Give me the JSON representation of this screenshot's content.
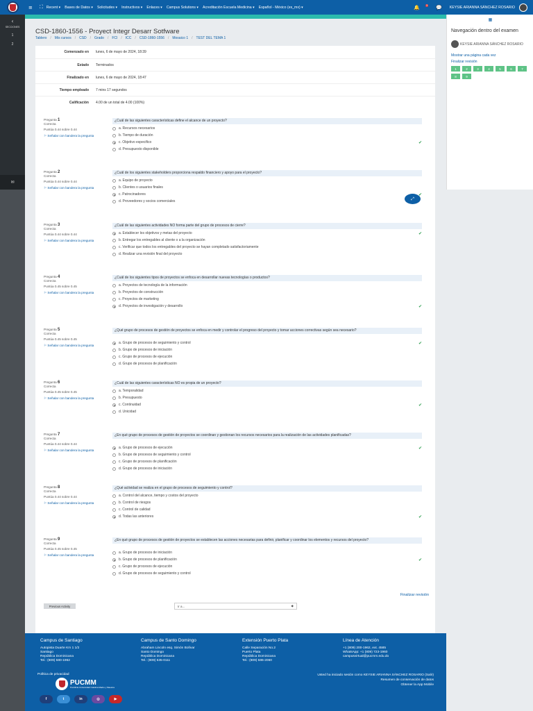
{
  "topbar": {
    "menu": [
      "Recent ▾",
      "Bases de Datos ▾",
      "Solicitudes ▾",
      "Instructivos ▾",
      "Enlaces ▾",
      "Campus Solutions ▾",
      "Acreditación Escuela Medicina ▾",
      "Español - México (es_mx) ▾"
    ],
    "notif_count": "3",
    "user_name": "KEYSIE ARIANNA SÁNCHEZ ROSARIO"
  },
  "leftrail": {
    "label": "SECCIONES",
    "items": [
      "1",
      "2"
    ]
  },
  "page": {
    "title": "CSD-1860-1556 - Proyect Integr Desarr Sotfware",
    "breadcrumb": [
      "Tablero",
      "Mis cursos",
      "CSD",
      "Grado",
      "FCI",
      "ICC",
      "CSD-1860-1556",
      "Mosaico 1",
      "TEST DEL TEMA 1"
    ]
  },
  "summary": [
    {
      "label": "Comenzado en",
      "value": "lunes, 6 de mayo de 2024, 18:39"
    },
    {
      "label": "Estado",
      "value": "Terminados"
    },
    {
      "label": "Finalizado en",
      "value": "lunes, 6 de mayo de 2024, 18:47"
    },
    {
      "label": "Tiempo empleado",
      "value": "7 mins 17 segundos"
    },
    {
      "label": "Calificación",
      "value": "4.00 de un total de 4.00 (100%)"
    }
  ],
  "question_labels": {
    "prefix": "Pregunta",
    "flag": "Señalar con bandera la pregunta"
  },
  "questions": [
    {
      "num": "1",
      "status": "Correcta",
      "grade": "Puntúa 0.44 sobre 0.44",
      "text": "¿Cuál de las siguientes características define el alcance de un proyecto?",
      "options": [
        "a. Recursos necesarios",
        "b. Tiempo de duración",
        "c. Objetivo especifico",
        "d. Presupuesto disponible"
      ],
      "selected": 2
    },
    {
      "num": "2",
      "status": "Correcta",
      "grade": "Puntúa 0.44 sobre 0.44",
      "text": "¿Cuál de los siguientes stakeholders proporciona respaldo financiero y apoyo para el proyecto?",
      "options": [
        "a. Equipo de proyecto",
        "b. Clientes o usuarios finales",
        "c. Patrocinadores",
        "d. Proveedores y socios comerciales"
      ],
      "selected": 2
    },
    {
      "num": "3",
      "status": "Correcta",
      "grade": "Puntúa 0.44 sobre 0.44",
      "text": "¿Cuál de las siguientes actividades NO forma parte del grupo de procesos de cierre?",
      "options": [
        "a. Establecer los objetivos y metas del proyecto",
        "b. Entregar los entregables al cliente o a la organización",
        "c. Verificar que todos los entregables del proyecto se hayan completado satisfactoriamente",
        "d. Realizar una revisión final del proyecto"
      ],
      "selected": 0
    },
    {
      "num": "4",
      "status": "Correcta",
      "grade": "Puntúa 0.45 sobre 0.45",
      "text": "¿Cuál de los siguientes tipos de proyectos se enfoca en desarrollar nuevas tecnologías o productos?",
      "options": [
        "a. Proyectos de tecnología de la información",
        "b. Proyectos de construcción",
        "c. Proyectos de marketing",
        "d. Proyectos de investigación y desarrollo"
      ],
      "selected": 3
    },
    {
      "num": "5",
      "status": "Correcta",
      "grade": "Puntúa 0.45 sobre 0.45",
      "text": "¿Qué grupo de procesos de gestión de proyectos se enfoca en medir y controlar el progreso del proyecto y tomar acciones correctivas según sea necesario?",
      "options": [
        "a. Grupo de procesos de seguimiento y control",
        "b. Grupo de procesos de iniciación",
        "c. Grupo de procesos de ejecución",
        "d. Grupo de procesos de planificación"
      ],
      "selected": 0
    },
    {
      "num": "6",
      "status": "Correcta",
      "grade": "Puntúa 0.45 sobre 0.45",
      "text": "¿Cuál de las siguientes características NO es propia de un proyecto?",
      "options": [
        "a. Temporalidad",
        "b. Presupuesto",
        "c. Continuidad",
        "d. Unicidad"
      ],
      "selected": 2
    },
    {
      "num": "7",
      "status": "Correcta",
      "grade": "Puntúa 0.44 sobre 0.44",
      "text": "¿En qué grupo de procesos de gestión de proyectos se coordinan y gestionan los recursos necesarios para la realización de las actividades planificadas?",
      "options": [
        "a. Grupo de procesos de ejecución",
        "b. Grupo de procesos de seguimiento y control",
        "c. Grupo de procesos de planificación",
        "d. Grupo de procesos de iniciación"
      ],
      "selected": 0
    },
    {
      "num": "8",
      "status": "Correcta",
      "grade": "Puntúa 0.44 sobre 0.44",
      "text": "¿Qué actividad se realiza en el grupo de procesos de seguimiento y control?",
      "options": [
        "a. Control del alcance, tiempo y costos del proyecto",
        "b. Control de riesgos",
        "c. Control de calidad",
        "d. Todas las anteriores"
      ],
      "selected": 3
    },
    {
      "num": "9",
      "status": "Correcta",
      "grade": "Puntúa 0.45 sobre 0.45",
      "text": "¿En qué grupo de procesos de gestión de proyectos se establecen las acciones necesarias para definir, planificar y coordinar los elementos y recursos del proyecto?",
      "options": [
        "a. Grupo de procesos de iniciación",
        "b. Grupo de procesos de planificación",
        "c. Grupo de procesos de ejecución",
        "d. Grupo de procesos de seguimiento y control"
      ],
      "selected": 1
    }
  ],
  "actions": {
    "finish_review": "Finalizar revisión",
    "previous_activity": "Previous Activity",
    "jump_to": "Ir a..."
  },
  "rightpanel": {
    "title": "Navegación dentro del examen",
    "user": "KEYSIE ARIANNA SÁNCHEZ ROSARIO",
    "show_one_page": "Mostrar una página cada vez",
    "finish_review": "Finalizar revisión",
    "nav": [
      "1",
      "2",
      "3",
      "4",
      "5",
      "6",
      "7",
      "8",
      "9"
    ]
  },
  "footer": {
    "columns": [
      {
        "title": "Campus de Santiago",
        "lines": [
          "Autopista Duarte Km 1 1/2",
          "Santiago",
          "República Dominicana",
          "Tel.: (809) 580-1962"
        ]
      },
      {
        "title": "Campus de Santo Domingo",
        "lines": [
          "Abraham Lincoln esq. Simón Bolívar",
          "Santo Domingo",
          "República Dominicana",
          "Tel.: (809) 535-0111"
        ]
      },
      {
        "title": "Extensión Puerto Plata",
        "lines": [
          "Calle Separación No.2",
          "Puerto Plata",
          "República Dominicana",
          "Tel.: (809) 586-2060"
        ]
      },
      {
        "title": "Línea de Atención",
        "lines": [
          "+1 (809) 200-1962, ext. 4585",
          "WhatsApp: +1 (809) 723-1960",
          "campusvirtual@pucmm.edu.do"
        ]
      }
    ],
    "privacy": "Política de privacidad",
    "logo_name": "PUCMM",
    "logo_sub": "Pontificia Universidad Católica Madre y Maestra",
    "session": "Usted ha iniciado sesión como KEYSIE ARIANNA SÁNCHEZ ROSARIO (Salir)",
    "retention": "Resumen de conservación de datos",
    "app": "Obtener la App Mobile",
    "socials": [
      {
        "name": "facebook",
        "glyph": "f",
        "color": "#1f3f7a"
      },
      {
        "name": "twitter",
        "glyph": "t",
        "color": "#3a8fd6"
      },
      {
        "name": "linkedin",
        "glyph": "in",
        "color": "#1f3f7a"
      },
      {
        "name": "instagram",
        "glyph": "◎",
        "color": "#6b4aa0"
      },
      {
        "name": "youtube",
        "glyph": "▶",
        "color": "#c62828"
      }
    ]
  }
}
